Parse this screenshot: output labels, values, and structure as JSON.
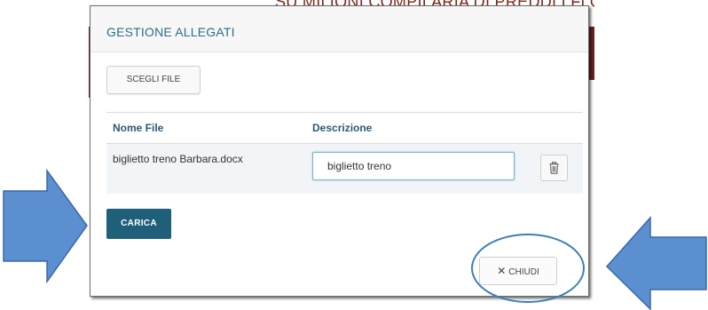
{
  "background": {
    "partial_title": "SU MILIONI COMPILARIA DI PREDDI I FLORINEI"
  },
  "modal": {
    "title": "GESTIONE ALLEGATI",
    "choose_file_label": "SCEGLI FILE",
    "table": {
      "columns": [
        "Nome File",
        "Descrizione"
      ],
      "rows": [
        {
          "file_name": "biglietto treno Barbara.docx",
          "description": "biglietto treno"
        }
      ]
    },
    "upload_label": "CARICA",
    "close_label": "CHIUDI"
  },
  "icons": {
    "delete": "trash-icon",
    "close": "close-x-icon"
  },
  "colors": {
    "title": "#2c6e8a",
    "header_text": "#2a5a78",
    "primary_button": "#1f5f7a",
    "row_background": "#f1f5f8",
    "arrow_fill": "#5b8fcf",
    "arrow_stroke": "#3a6aa8",
    "highlight_ellipse": "#3d7fb8"
  }
}
